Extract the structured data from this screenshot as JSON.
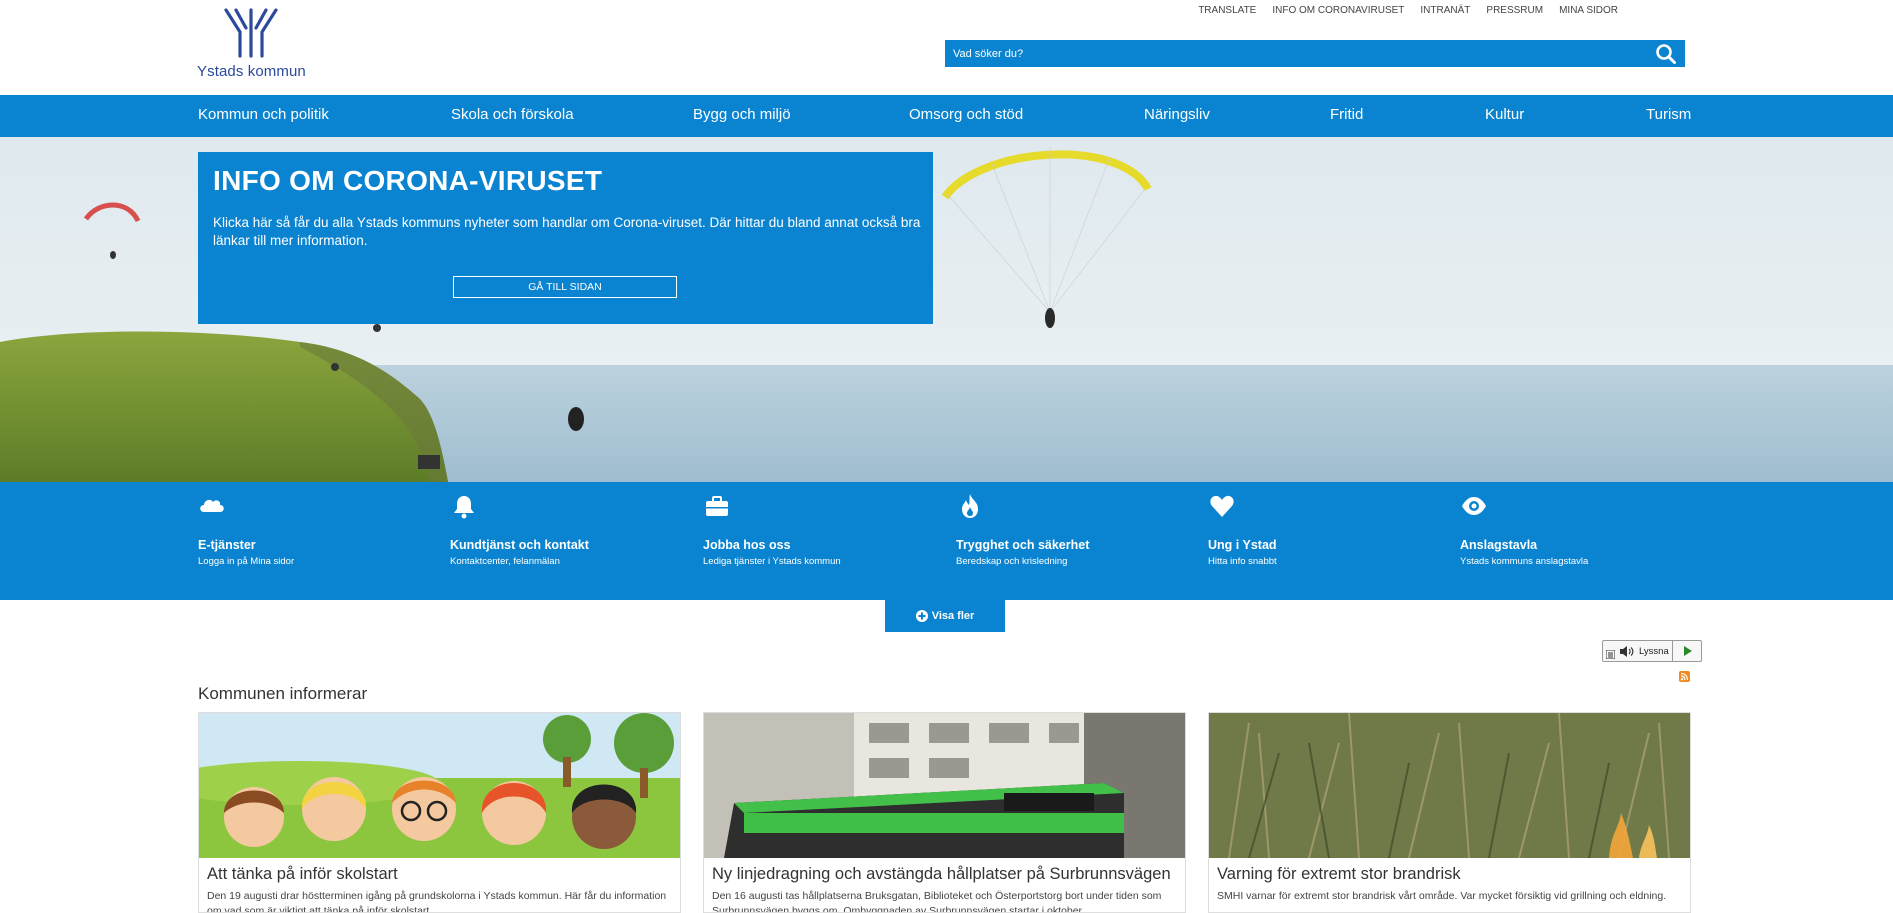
{
  "header": {
    "logo_text": "Ystads kommun",
    "toplinks": [
      "TRANSLATE",
      "INFO OM CORONAVIRUSET",
      "INTRANÄT",
      "PRESSRUM",
      "MINA SIDOR"
    ],
    "search_placeholder": "Vad söker du?",
    "search_icon": "search-icon"
  },
  "nav": {
    "items": [
      "Kommun och politik",
      "Skola och förskola",
      "Bygg och miljö",
      "Omsorg och stöd",
      "Näringsliv",
      "Fritid",
      "Kultur",
      "Turism"
    ]
  },
  "hero": {
    "title": "INFO OM CORONA-VIRUSET",
    "text": "Klicka här så får du alla Ystads kommuns nyheter som handlar om Corona-viruset. Där hittar du bland annat också bra länkar till mer information.",
    "button": "GÅ TILL SIDAN"
  },
  "services": [
    {
      "icon": "cloud-icon",
      "title": "E-tjänster",
      "sub": "Logga in på Mina sidor"
    },
    {
      "icon": "bell-icon",
      "title": "Kundtjänst och kontakt",
      "sub": "Kontaktcenter, felanmälan"
    },
    {
      "icon": "briefcase-icon",
      "title": "Jobba hos oss",
      "sub": "Lediga tjänster i Ystads kommun"
    },
    {
      "icon": "fire-icon",
      "title": "Trygghet och säkerhet",
      "sub": "Beredskap och krisledning"
    },
    {
      "icon": "heart-icon",
      "title": "Ung i Ystad",
      "sub": "Hitta info snabbt"
    },
    {
      "icon": "eye-icon",
      "title": "Anslagstavla",
      "sub": "Ystads kommuns anslagstavla"
    }
  ],
  "visa_fler": "Visa fler",
  "lyssna": "Lyssna",
  "news": {
    "heading": "Kommunen informerar",
    "cards": [
      {
        "title": "Att tänka på inför skolstart",
        "text": "Den 19 augusti drar höstterminen igång på grundskolorna i Ystads kommun. Här får du information om vad som är viktigt att tänka på inför skolstart."
      },
      {
        "title": "Ny linjedragning och avstängda hållplatser på Surbrunnsvägen",
        "text": "Den 16 augusti tas hållplatserna Bruksgatan, Biblioteket och Österportstorg bort under tiden som Surbrunnsvägen byggs om. Ombyggnaden av Surbrunnsvägen startar i oktober."
      },
      {
        "title": "Varning för extremt stor brandrisk",
        "text": "SMHI varnar för extremt stor brandrisk vårt område. Var mycket försiktig vid grillning och eldning."
      }
    ]
  },
  "colors": {
    "brand_blue": "#0a84d0",
    "logo_blue": "#2b4a9c"
  }
}
